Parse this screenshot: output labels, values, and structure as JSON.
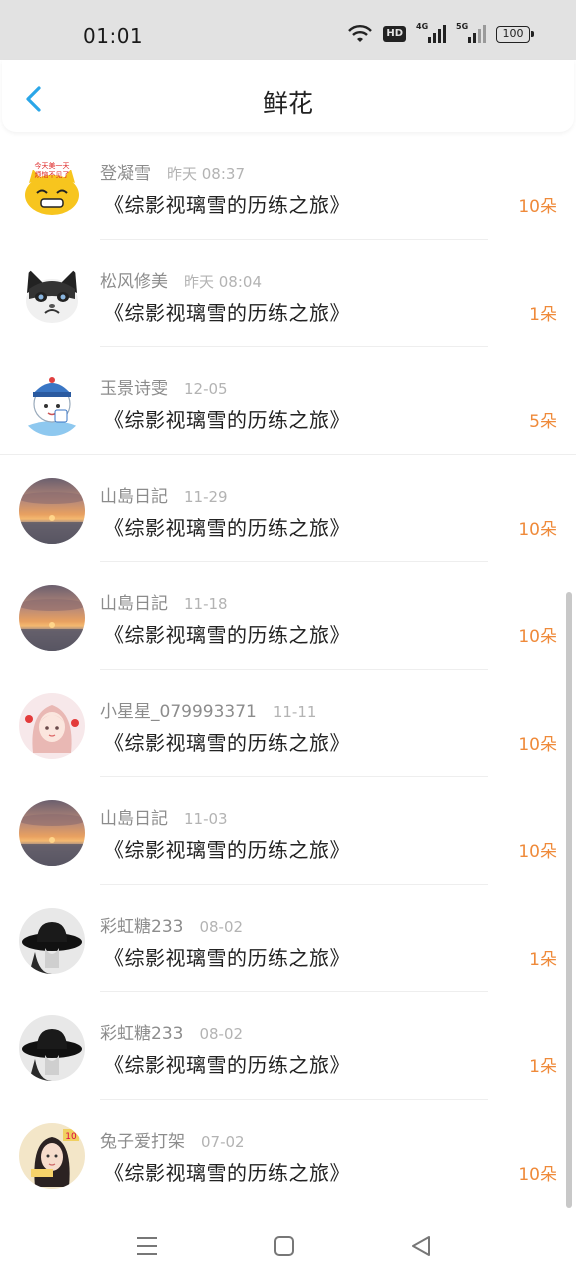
{
  "status_bar": {
    "time": "01:01",
    "hd": "HD",
    "net1": "4G",
    "net2": "5G",
    "battery": "100"
  },
  "header": {
    "title": "鲜花",
    "back_icon": "chevron-left-icon",
    "accent_color": "#2aa6e8"
  },
  "records": [
    {
      "user": "登凝雪",
      "time": "昨天 08:37",
      "book": "《综影视璃雪的历练之旅》",
      "count": "10朵",
      "avatar": "yellow-cat-sticker"
    },
    {
      "user": "松风修美",
      "time": "昨天 08:04",
      "book": "《综影视璃雪的历练之旅》",
      "count": "1朵",
      "avatar": "grumpy-cat"
    },
    {
      "user": "玉景诗雯",
      "time": "12-05",
      "book": "《综影视璃雪的历练之旅》",
      "count": "5朵",
      "avatar": "cartoon-character"
    },
    {
      "user": "山島日記",
      "time": "11-29",
      "book": "《综影视璃雪的历练之旅》",
      "count": "10朵",
      "avatar": "sunset"
    },
    {
      "user": "山島日記",
      "time": "11-18",
      "book": "《综影视璃雪的历练之旅》",
      "count": "10朵",
      "avatar": "sunset"
    },
    {
      "user": "小星星_079993371",
      "time": "11-11",
      "book": "《综影视璃雪的历练之旅》",
      "count": "10朵",
      "avatar": "anime-girl"
    },
    {
      "user": "山島日記",
      "time": "11-03",
      "book": "《综影视璃雪的历练之旅》",
      "count": "10朵",
      "avatar": "sunset"
    },
    {
      "user": "彩虹糖233",
      "time": "08-02",
      "book": "《综影视璃雪的历练之旅》",
      "count": "1朵",
      "avatar": "black-hat"
    },
    {
      "user": "彩虹糖233",
      "time": "08-02",
      "book": "《综影视璃雪的历练之旅》",
      "count": "1朵",
      "avatar": "black-hat"
    },
    {
      "user": "兔子爱打架",
      "time": "07-02",
      "book": "《综影视璃雪的历练之旅》",
      "count": "10朵",
      "avatar": "girl-portrait"
    }
  ],
  "colors": {
    "count": "#ef8a3a",
    "username": "#8c8c8c",
    "time": "#b3b3b3"
  },
  "navbar": {
    "menu_icon": "menu-icon",
    "home_icon": "home-square-icon",
    "back_icon": "back-triangle-icon"
  }
}
